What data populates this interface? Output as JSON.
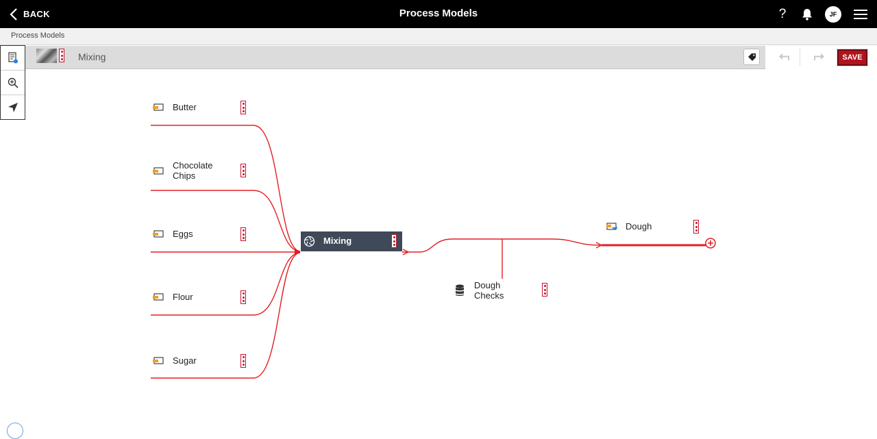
{
  "header": {
    "back_label": "BACK",
    "title": "Process Models"
  },
  "breadcrumb": "Process Models",
  "model": {
    "name": "Mixing"
  },
  "toolbar": {
    "save_label": "SAVE"
  },
  "inputs": [
    {
      "label": "Butter"
    },
    {
      "label": "Chocolate Chips"
    },
    {
      "label": "Eggs"
    },
    {
      "label": "Flour"
    },
    {
      "label": "Sugar"
    }
  ],
  "process": {
    "label": "Mixing"
  },
  "check": {
    "label": "Dough Checks"
  },
  "output": {
    "label": "Dough"
  },
  "user": {
    "initials": "JF"
  },
  "colors": {
    "accent": "#c8102e",
    "process_fill": "#3f4957",
    "save_bg": "#b0141e"
  }
}
